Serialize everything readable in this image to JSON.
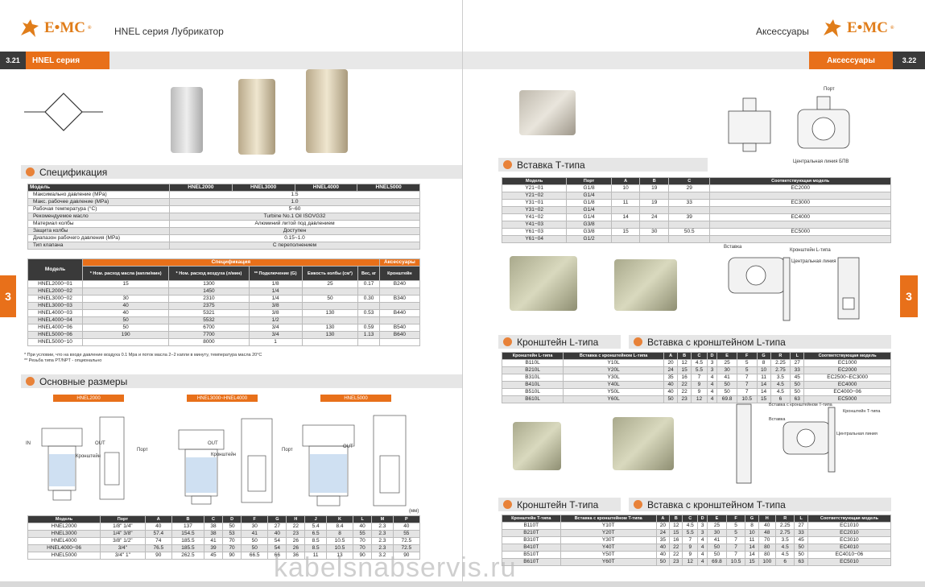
{
  "left_header": {
    "brand": "E•MC",
    "registered": "®",
    "title": "HNEL серия Лубрикатор",
    "page_num": "3.21",
    "tag": "HNEL серия",
    "side_tab": "3"
  },
  "right_header": {
    "brand": "E•MC",
    "registered": "®",
    "title": "Аксессуары",
    "page_num": "3.22",
    "tag": "Аксессуары",
    "side_tab": "3"
  },
  "spec": {
    "heading": "Спецификация",
    "cols": [
      "Модель",
      "HNEL2000",
      "HNEL3000",
      "HNEL4000",
      "HNEL5000"
    ],
    "rows": [
      [
        "Максимально давление (MPa)",
        "1.5"
      ],
      [
        "Макс. рабочее давление (MPa)",
        "1.0"
      ],
      [
        "Рабочая температура (°C)",
        "5~60"
      ],
      [
        "Рекомендуемое масло",
        "Turbine No.1 Oil   ISOVG32"
      ],
      [
        "Материал колбы",
        "Алюминий литой под давлением"
      ],
      [
        "Защита колбы",
        "Доступен"
      ],
      [
        "Диапазон рабочего давления (MPa)",
        "0.15~1.0"
      ],
      [
        "Тип клапана",
        "С переполнением"
      ]
    ]
  },
  "spec2": {
    "h_model": "Модель",
    "h_spec": "Спецификация",
    "h_acc": "Аксессуары",
    "sub": [
      "* Ном. расход масла (капли/мин)",
      "* Ном. расход воздуха (л/мин)",
      "** Подключение (G)",
      "Емкость колбы (см³)",
      "Вес, кг",
      "Кронштейн"
    ],
    "rows": [
      [
        "HNEL2000−01",
        "15",
        "1300",
        "1/8",
        "25",
        "0.17",
        "B240"
      ],
      [
        "HNEL2000−02",
        "",
        "1450",
        "1/4",
        "",
        "",
        ""
      ],
      [
        "HNEL3000−02",
        "30",
        "2310",
        "1/4",
        "50",
        "0.30",
        "B340"
      ],
      [
        "HNEL3000−03",
        "40",
        "2375",
        "3/8",
        "",
        "",
        ""
      ],
      [
        "HNEL4000−03",
        "40",
        "5321",
        "3/8",
        "130",
        "0.53",
        "B440"
      ],
      [
        "HNEL4000−04",
        "50",
        "5532",
        "1/2",
        "",
        "",
        ""
      ],
      [
        "HNEL4000−06",
        "50",
        "6700",
        "3/4",
        "130",
        "0.59",
        "B540"
      ],
      [
        "HNEL5000−06",
        "190",
        "7700",
        "3/4",
        "130",
        "1.13",
        "B640"
      ],
      [
        "HNEL5000−10",
        "",
        "8000",
        "1",
        "",
        "",
        ""
      ]
    ],
    "note1": "* При условии, что на входе давление воздуха 0.1 Mpa и поток масла 2−2 капли в минуту, температура масла 20°C",
    "note2": "** Резьба типа PT/NPT - опционально"
  },
  "dims": {
    "heading": "Основные размеры",
    "chips": [
      "HNEL2000",
      "HNEL3000~HNEL4000",
      "HNEL5000"
    ],
    "unit": "(мм)",
    "cols": [
      "Модель",
      "Порт",
      "A",
      "B",
      "C",
      "D",
      "F",
      "G",
      "H",
      "J",
      "K",
      "L",
      "M",
      "P"
    ],
    "rows": [
      [
        "HNEL2000",
        "1/8\" 1/4\"",
        "40",
        "137",
        "38",
        "50",
        "30",
        "27",
        "22",
        "5.4",
        "8.4",
        "40",
        "2.3",
        "40"
      ],
      [
        "HNEL3000",
        "1/4\" 3/8\"",
        "57.4",
        "154.5",
        "38",
        "53",
        "41",
        "40",
        "23",
        "6.5",
        "8",
        "55",
        "2.3",
        "55"
      ],
      [
        "HNEL4000",
        "3/8\" 1/2\"",
        "74",
        "185.5",
        "41",
        "70",
        "50",
        "54",
        "26",
        "8.5",
        "10.5",
        "70",
        "2.3",
        "72.5"
      ],
      [
        "HNEL4000−06",
        "3/4\"",
        "76.5",
        "185.5",
        "39",
        "70",
        "50",
        "54",
        "26",
        "8.5",
        "10.5",
        "70",
        "2.3",
        "72.5"
      ],
      [
        "HNEL5000",
        "3/4\" 1\"",
        "90",
        "262.5",
        "45",
        "90",
        "66.5",
        "66",
        "36",
        "11",
        "13",
        "90",
        "3.2",
        "90"
      ]
    ],
    "labels": {
      "port": "Порт",
      "bracket": "Кронштейн",
      "in": "IN",
      "out": "OUT"
    }
  },
  "ttype": {
    "heading": "Вставка Т-типа",
    "cols": [
      "Модель",
      "Порт",
      "A",
      "B",
      "C",
      "Соответствующая модель"
    ],
    "rows": [
      [
        "Y21−01",
        "G1/8",
        "10",
        "19",
        "29",
        "EC2000"
      ],
      [
        "Y21−02",
        "G1/4",
        "",
        "",
        "",
        ""
      ],
      [
        "Y31−01",
        "G1/8",
        "11",
        "19",
        "33",
        "EC3000"
      ],
      [
        "Y31−02",
        "G1/4",
        "",
        "",
        "",
        ""
      ],
      [
        "Y41−02",
        "G1/4",
        "14",
        "24",
        "39",
        "EC4000"
      ],
      [
        "Y41−03",
        "G3/8",
        "",
        "",
        "",
        ""
      ],
      [
        "Y61−03",
        "G3/8",
        "15",
        "30",
        "50.5",
        "EC5000"
      ],
      [
        "Y61−04",
        "G1/2",
        "",
        "",
        "",
        ""
      ]
    ],
    "labels": {
      "port": "Порт",
      "center": "Центральная линия БПВ"
    }
  },
  "lbracket": {
    "heading": "Кронштейн L-типа",
    "heading2": "Вставка с кронштейном L-типа",
    "cols": [
      "Кронштейн L-типа",
      "Вставка с кронштейном L-типа",
      "A",
      "B",
      "C",
      "D",
      "E",
      "F",
      "G",
      "R",
      "L",
      "Соответствующая модель"
    ],
    "rows": [
      [
        "B110L",
        "Y10L",
        "20",
        "12",
        "4.5",
        "3",
        "25",
        "5",
        "8",
        "2.25",
        "27",
        "EC1000"
      ],
      [
        "B210L",
        "Y20L",
        "24",
        "15",
        "5.5",
        "3",
        "30",
        "5",
        "10",
        "2.75",
        "33",
        "EC2000"
      ],
      [
        "B310L",
        "Y30L",
        "35",
        "16",
        "7",
        "4",
        "41",
        "7",
        "11",
        "3.5",
        "45",
        "EC2500~EC3000"
      ],
      [
        "B410L",
        "Y40L",
        "40",
        "22",
        "9",
        "4",
        "50",
        "7",
        "14",
        "4.5",
        "50",
        "EC4000"
      ],
      [
        "B510L",
        "Y50L",
        "40",
        "22",
        "9",
        "4",
        "50",
        "7",
        "14",
        "4.5",
        "50",
        "EC4000−06"
      ],
      [
        "B610L",
        "Y60L",
        "50",
        "23",
        "12",
        "4",
        "69.8",
        "10.5",
        "15",
        "6",
        "63",
        "EC5000"
      ]
    ],
    "labels": {
      "insert": "Вставка",
      "bracket": "Кронштейн L-типа",
      "center": "Центральная линия"
    }
  },
  "tbracket": {
    "heading": "Кронштейн T-типа",
    "heading2": "Вставка с кронштейном T-типа",
    "cols": [
      "Кронштейн T-типа",
      "Вставка с кронштейном T-типа",
      "A",
      "B",
      "C",
      "D",
      "E",
      "F",
      "G",
      "H",
      "R",
      "L",
      "Соответствующая модель"
    ],
    "rows": [
      [
        "B110T",
        "Y10T",
        "20",
        "12",
        "4.5",
        "3",
        "25",
        "5",
        "8",
        "40",
        "2.25",
        "27",
        "EC1010"
      ],
      [
        "B210T",
        "Y20T",
        "24",
        "15",
        "5.5",
        "3",
        "30",
        "5",
        "10",
        "48",
        "2.75",
        "33",
        "EC2010"
      ],
      [
        "B310T",
        "Y30T",
        "35",
        "16",
        "7",
        "4",
        "41",
        "7",
        "11",
        "70",
        "3.5",
        "45",
        "EC3010"
      ],
      [
        "B410T",
        "Y40T",
        "40",
        "22",
        "9",
        "4",
        "50",
        "7",
        "14",
        "80",
        "4.5",
        "50",
        "EC4010"
      ],
      [
        "B510T",
        "Y50T",
        "40",
        "22",
        "9",
        "4",
        "50",
        "7",
        "14",
        "80",
        "4.5",
        "50",
        "EC4010−06"
      ],
      [
        "B610T",
        "Y60T",
        "50",
        "23",
        "12",
        "4",
        "69.8",
        "10.5",
        "15",
        "100",
        "6",
        "63",
        "EC5010"
      ]
    ],
    "labels": {
      "insert_bracket": "Вставка с кронштейном T-типа",
      "bracket": "Кронштейн T-типа",
      "insert": "Вставка",
      "center": "Центральная линия"
    }
  },
  "watermark": "kabelsnabservis.ru",
  "colors": {
    "accent": "#e8701a",
    "dark": "#3a3a3a",
    "band": "#e6e6e6"
  }
}
